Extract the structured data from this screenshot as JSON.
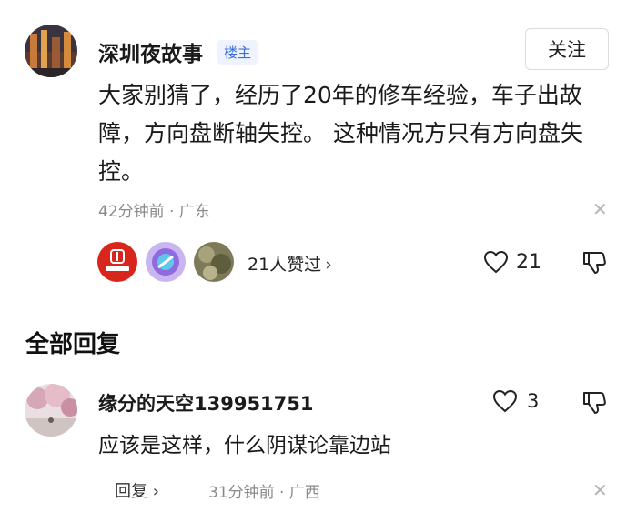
{
  "post": {
    "author": "深圳夜故事",
    "badge": "楼主",
    "follow_label": "关注",
    "body": "大家别猜了，经历了20年的修车经验，车子出故障，方向盘断轴失控。 这种情况方只有方向盘失控。",
    "meta": "42分钟前 · 广东",
    "likes_text": "21人赞过",
    "like_count": "21"
  },
  "section_title": "全部回复",
  "reply": {
    "author": "缘分的天空139951751",
    "body": "应该是这样，什么阴谋论靠边站",
    "reply_label": "回复",
    "meta": "31分钟前 · 广西",
    "like_count": "3"
  },
  "icons": {
    "close": "close-icon",
    "heart": "heart-icon",
    "dislike": "thumbs-down-icon",
    "chevron": "chevron-right-icon"
  },
  "colors": {
    "badge_text": "#3b6fd6",
    "badge_bg": "#eef3ff",
    "meta_text": "#8a8a8a"
  }
}
